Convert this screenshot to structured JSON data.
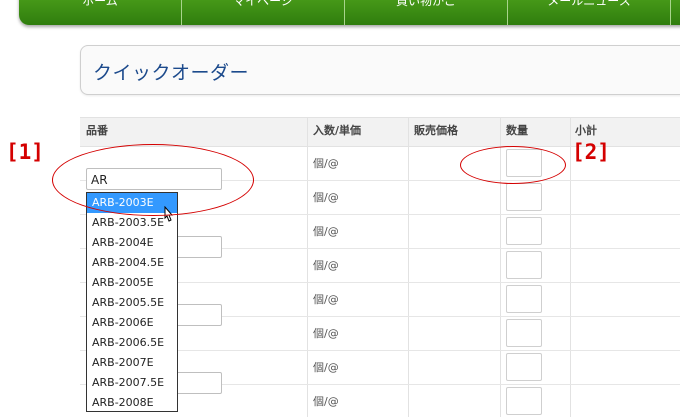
{
  "nav": {
    "items": [
      "ホーム",
      "マイページ",
      "買い物かご",
      "メールニュース"
    ]
  },
  "page": {
    "title": "クイックオーダー"
  },
  "table": {
    "headers": [
      "品番",
      "入数/単価",
      "販売価格",
      "数量",
      "小計"
    ],
    "unit_label": "個/@"
  },
  "input": {
    "value": "AR"
  },
  "dropdown": {
    "selected_index": 0,
    "options": [
      "ARB-2003E",
      "ARB-2003.5E",
      "ARB-2004E",
      "ARB-2004.5E",
      "ARB-2005E",
      "ARB-2005.5E",
      "ARB-2006E",
      "ARB-2006.5E",
      "ARB-2007E",
      "ARB-2007.5E",
      "ARB-2008E"
    ]
  },
  "annotations": {
    "label1": "[1]",
    "label2": "[2]",
    "color": "#d40000"
  },
  "colors": {
    "nav_green": "#3a8c12",
    "title_blue": "#1c4a8c",
    "highlight": "#3399ff"
  }
}
